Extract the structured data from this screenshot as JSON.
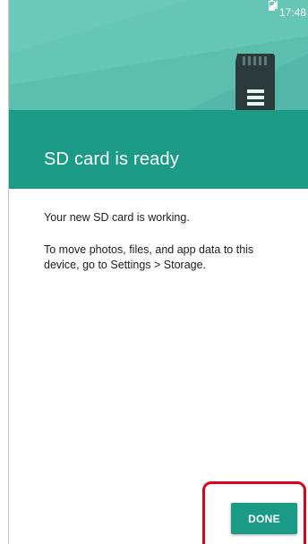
{
  "status_bar": {
    "time": "17:48",
    "signal_icon": "signal-icon",
    "battery_icon": "battery-icon"
  },
  "header": {
    "title": "SD card is ready",
    "illustration_icon": "sd-card-icon"
  },
  "body": {
    "line1": "Your new SD card is working.",
    "line2": "To move photos, files, and app data to this device, go to Settings > Storage."
  },
  "actions": {
    "done_label": "DONE"
  },
  "colors": {
    "hero": "#5cbfae",
    "title_band": "#1b9a86",
    "button": "#1b9a86",
    "highlight": "#e0001b"
  }
}
